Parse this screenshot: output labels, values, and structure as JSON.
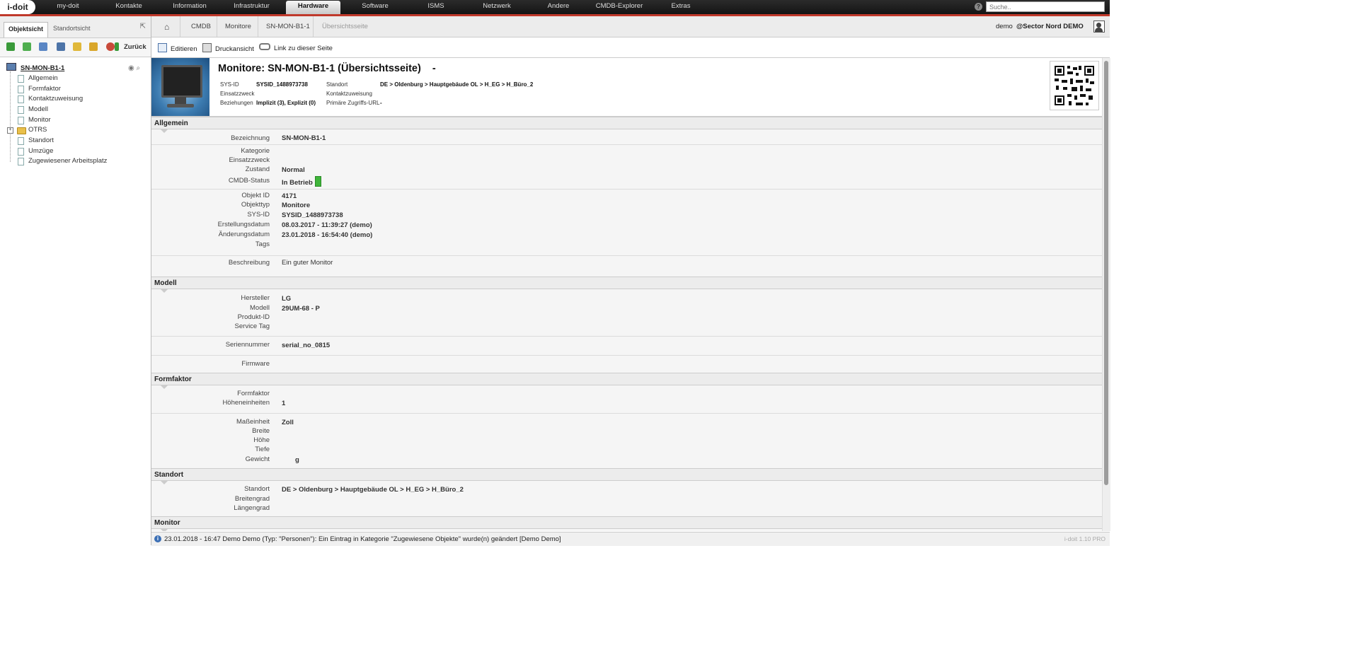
{
  "topnav": {
    "logo": "i-doit",
    "items": [
      "my-doit",
      "Kontakte",
      "Information",
      "Infrastruktur",
      "Hardware",
      "Software",
      "ISMS",
      "Netzwerk",
      "Andere",
      "CMDB-Explorer",
      "Extras"
    ],
    "active": "Hardware",
    "search_placeholder": "Suche..",
    "accent_color": "#c0392b"
  },
  "left": {
    "tabs": [
      "Objektsicht",
      "Standortsicht"
    ],
    "back_label": "Zurück",
    "tree": {
      "root": "SN-MON-B1-1",
      "items": [
        "Allgemein",
        "Formfaktor",
        "Kontaktzuweisung",
        "Modell",
        "Monitor",
        "OTRS",
        "Standort",
        "Umzüge",
        "Zugewiesener Arbeitsplatz"
      ]
    }
  },
  "breadcrumb": {
    "items": [
      "CMDB",
      "Monitore",
      "SN-MON-B1-1",
      "Übersichtsseite"
    ],
    "user": "demo",
    "tenant": "@Sector Nord DEMO"
  },
  "actions": {
    "edit": "Editieren",
    "print": "Druckansicht",
    "link": "Link zu dieser Seite"
  },
  "header": {
    "title": "Monitore: SN-MON-B1-1 (Übersichtsseite)",
    "title_suffix": "-",
    "left_labels": [
      "SYS-ID",
      "Einsatzzweck",
      "Beziehungen"
    ],
    "left_values": [
      "SYSID_1488973738",
      "",
      "Implizit (3), Explizit (0)"
    ],
    "right_labels": [
      "Standort",
      "Kontaktzuweisung",
      "Primäre Zugriffs-URL"
    ],
    "right_values": [
      "DE > Oldenburg > Hauptgebäude OL > H_EG > H_Büro_2",
      "",
      "-"
    ]
  },
  "sections": {
    "allgemein": {
      "title": "Allgemein",
      "bezeichnung": {
        "label": "Bezeichnung",
        "value": "SN-MON-B1-1"
      },
      "kategorie": {
        "label": "Kategorie",
        "value": ""
      },
      "einsatzzweck": {
        "label": "Einsatzzweck",
        "value": ""
      },
      "zustand": {
        "label": "Zustand",
        "value": "Normal"
      },
      "cmdb_status": {
        "label": "CMDB-Status",
        "value": "In Betrieb",
        "color": "#3fb43a"
      },
      "objekt_id": {
        "label": "Objekt ID",
        "value": "4171"
      },
      "objekttyp": {
        "label": "Objekttyp",
        "value": "Monitore"
      },
      "sys_id": {
        "label": "SYS-ID",
        "value": "SYSID_1488973738"
      },
      "erstellungsdatum": {
        "label": "Erstellungsdatum",
        "value": "08.03.2017 - 11:39:27 (demo)"
      },
      "aenderungsdatum": {
        "label": "Änderungsdatum",
        "value": "23.01.2018 - 16:54:40 (demo)"
      },
      "tags": {
        "label": "Tags",
        "value": ""
      },
      "beschreibung": {
        "label": "Beschreibung",
        "value": "Ein guter Monitor"
      }
    },
    "modell": {
      "title": "Modell",
      "hersteller": {
        "label": "Hersteller",
        "value": "LG"
      },
      "modell": {
        "label": "Modell",
        "value": "29UM-68 - P"
      },
      "produkt_id": {
        "label": "Produkt-ID",
        "value": ""
      },
      "service_tag": {
        "label": "Service Tag",
        "value": ""
      },
      "seriennummer": {
        "label": "Seriennummer",
        "value": "serial_no_0815"
      },
      "firmware": {
        "label": "Firmware",
        "value": ""
      }
    },
    "formfaktor": {
      "title": "Formfaktor",
      "formfaktor": {
        "label": "Formfaktor",
        "value": ""
      },
      "hoeheneinheiten": {
        "label": "Höheneinheiten",
        "value": "1"
      },
      "masseinheit": {
        "label": "Maßeinheit",
        "value": "Zoll"
      },
      "breite": {
        "label": "Breite",
        "value": ""
      },
      "hoehe": {
        "label": "Höhe",
        "value": ""
      },
      "tiefe": {
        "label": "Tiefe",
        "value": ""
      },
      "gewicht": {
        "label": "Gewicht",
        "value": "g"
      }
    },
    "standort": {
      "title": "Standort",
      "standort": {
        "label": "Standort",
        "value": "DE > Oldenburg > Hauptgebäude OL > H_EG > H_Büro_2"
      },
      "breitengrad": {
        "label": "Breitengrad",
        "value": ""
      },
      "laengengrad": {
        "label": "Längengrad",
        "value": ""
      }
    },
    "monitor": {
      "title": "Monitor"
    }
  },
  "statusbar": {
    "message": "23.01.2018 - 16:47 Demo Demo (Typ: \"Personen\"): Ein Eintrag in Kategorie \"Zugewiesene Objekte\" wurde(n) geändert [Demo Demo]",
    "version": "i-doit 1.10 PRO"
  }
}
